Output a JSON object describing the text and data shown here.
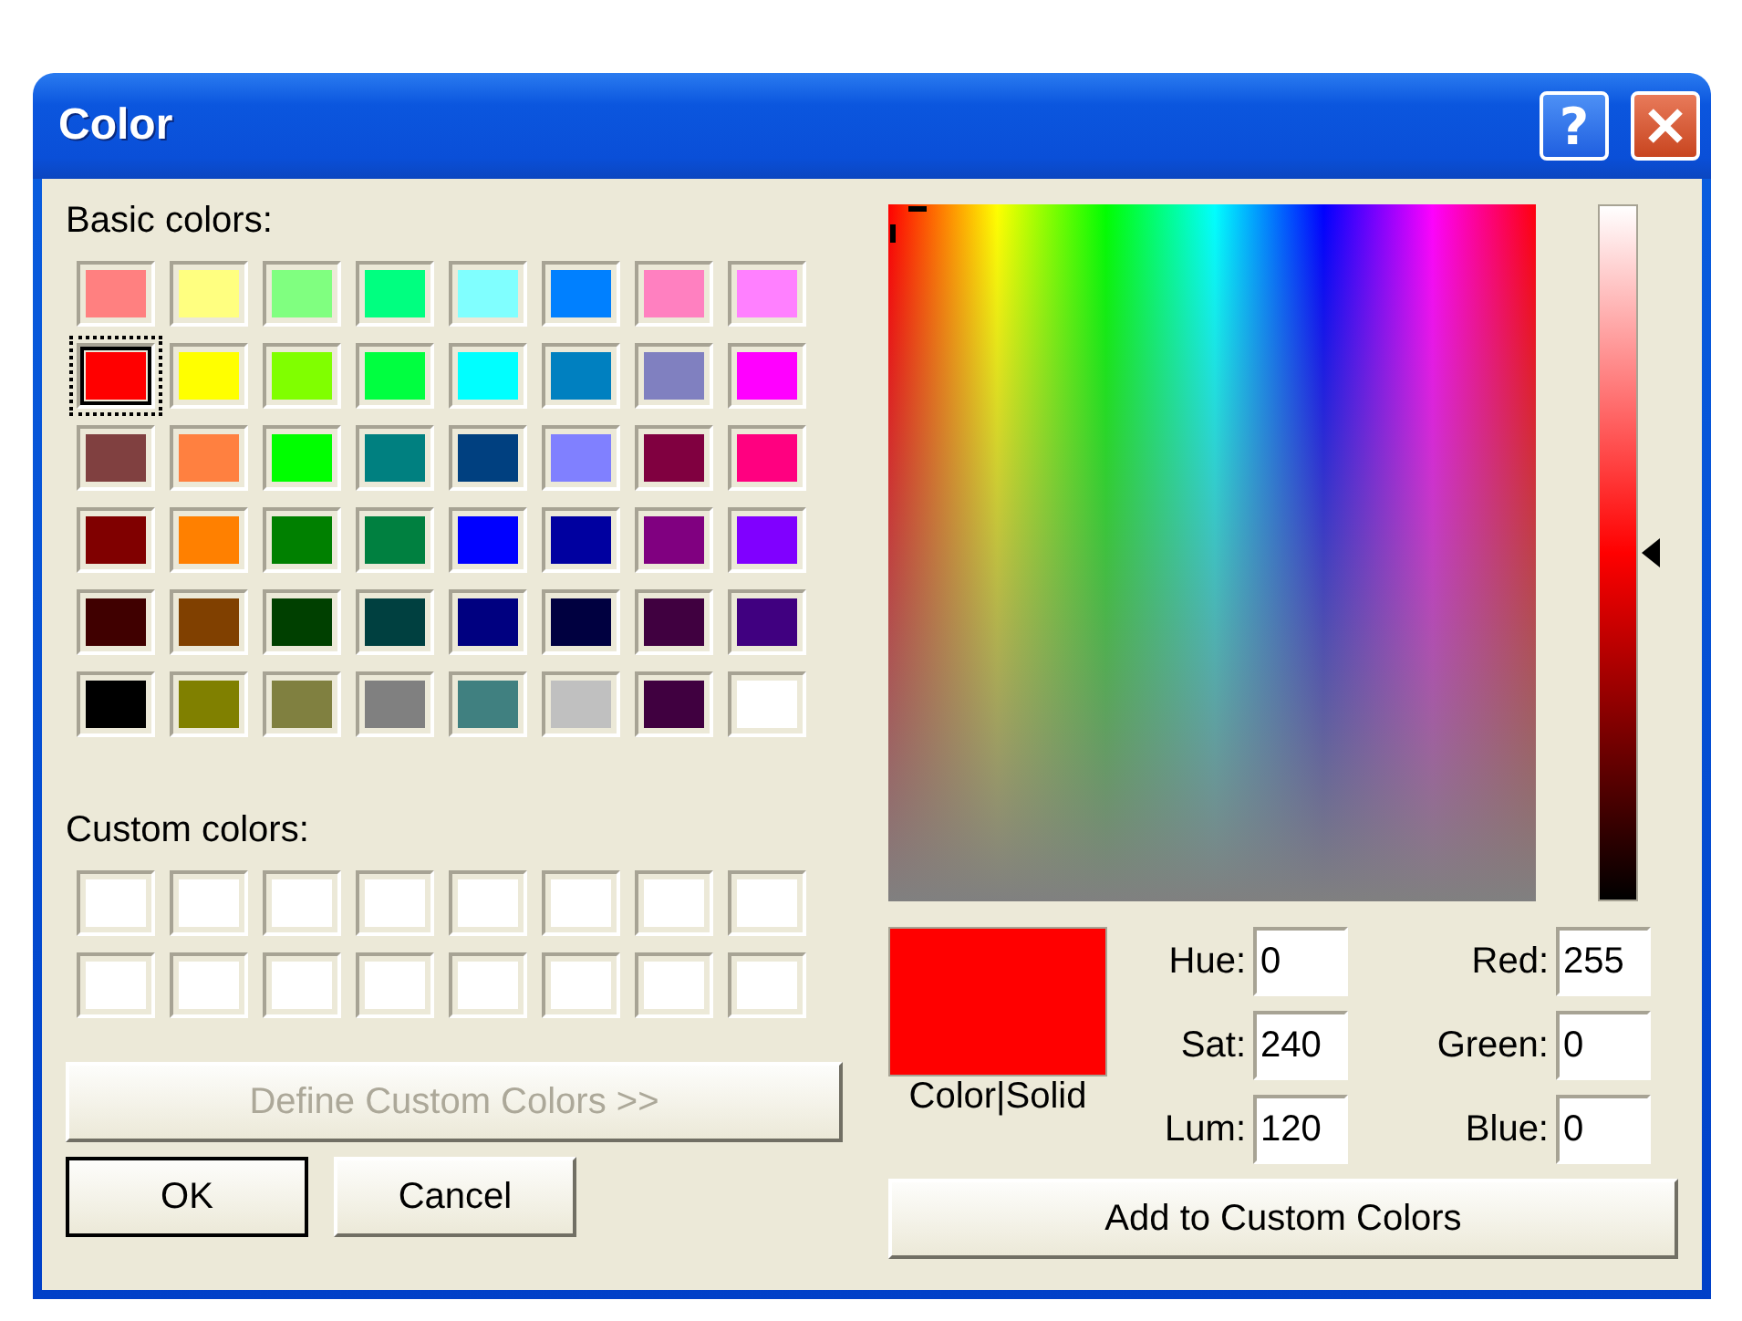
{
  "window": {
    "title": "Color",
    "help_label": "?"
  },
  "basic_colors_label": "Basic colors:",
  "basic_colors": [
    {
      "color": "#ff8080",
      "selected": false
    },
    {
      "color": "#ffff80",
      "selected": false
    },
    {
      "color": "#80ff80",
      "selected": false
    },
    {
      "color": "#00ff80",
      "selected": false
    },
    {
      "color": "#80ffff",
      "selected": false
    },
    {
      "color": "#0080ff",
      "selected": false
    },
    {
      "color": "#ff80c0",
      "selected": false
    },
    {
      "color": "#ff80ff",
      "selected": false
    },
    {
      "color": "#ff0000",
      "selected": true
    },
    {
      "color": "#ffff00",
      "selected": false
    },
    {
      "color": "#80ff00",
      "selected": false
    },
    {
      "color": "#00ff40",
      "selected": false
    },
    {
      "color": "#00ffff",
      "selected": false
    },
    {
      "color": "#0080c0",
      "selected": false
    },
    {
      "color": "#8080c0",
      "selected": false
    },
    {
      "color": "#ff00ff",
      "selected": false
    },
    {
      "color": "#804040",
      "selected": false
    },
    {
      "color": "#ff8040",
      "selected": false
    },
    {
      "color": "#00ff00",
      "selected": false
    },
    {
      "color": "#008080",
      "selected": false
    },
    {
      "color": "#004080",
      "selected": false
    },
    {
      "color": "#8080ff",
      "selected": false
    },
    {
      "color": "#800040",
      "selected": false
    },
    {
      "color": "#ff0080",
      "selected": false
    },
    {
      "color": "#800000",
      "selected": false
    },
    {
      "color": "#ff8000",
      "selected": false
    },
    {
      "color": "#008000",
      "selected": false
    },
    {
      "color": "#008040",
      "selected": false
    },
    {
      "color": "#0000ff",
      "selected": false
    },
    {
      "color": "#0000a0",
      "selected": false
    },
    {
      "color": "#800080",
      "selected": false
    },
    {
      "color": "#8000ff",
      "selected": false
    },
    {
      "color": "#400000",
      "selected": false
    },
    {
      "color": "#804000",
      "selected": false
    },
    {
      "color": "#004000",
      "selected": false
    },
    {
      "color": "#004040",
      "selected": false
    },
    {
      "color": "#000080",
      "selected": false
    },
    {
      "color": "#000040",
      "selected": false
    },
    {
      "color": "#400040",
      "selected": false
    },
    {
      "color": "#400080",
      "selected": false
    },
    {
      "color": "#000000",
      "selected": false
    },
    {
      "color": "#808000",
      "selected": false
    },
    {
      "color": "#808040",
      "selected": false
    },
    {
      "color": "#808080",
      "selected": false
    },
    {
      "color": "#408080",
      "selected": false
    },
    {
      "color": "#c0c0c0",
      "selected": false
    },
    {
      "color": "#400040",
      "selected": false
    },
    {
      "color": "#ffffff",
      "selected": false
    }
  ],
  "custom_colors_label": "Custom colors:",
  "custom_colors": [
    {
      "color": "#ffffff"
    },
    {
      "color": "#ffffff"
    },
    {
      "color": "#ffffff"
    },
    {
      "color": "#ffffff"
    },
    {
      "color": "#ffffff"
    },
    {
      "color": "#ffffff"
    },
    {
      "color": "#ffffff"
    },
    {
      "color": "#ffffff"
    },
    {
      "color": "#ffffff"
    },
    {
      "color": "#ffffff"
    },
    {
      "color": "#ffffff"
    },
    {
      "color": "#ffffff"
    },
    {
      "color": "#ffffff"
    },
    {
      "color": "#ffffff"
    },
    {
      "color": "#ffffff"
    },
    {
      "color": "#ffffff"
    }
  ],
  "define_button": {
    "label": "Define Custom Colors >>",
    "disabled": true
  },
  "dialog_buttons": [
    {
      "label": "OK",
      "default": true
    },
    {
      "label": "Cancel",
      "default": false
    }
  ],
  "luminosity_slider": {
    "level": 0.5
  },
  "preview": {
    "color": "#ff0000",
    "label": "Color|Solid"
  },
  "hsl_fields": [
    {
      "label": "Hue:",
      "value": "0"
    },
    {
      "label": "Sat:",
      "value": "240"
    },
    {
      "label": "Lum:",
      "value": "120"
    }
  ],
  "rgb_fields": [
    {
      "label": "Red:",
      "value": "255"
    },
    {
      "label": "Green:",
      "value": "0"
    },
    {
      "label": "Blue:",
      "value": "0"
    }
  ],
  "add_button": {
    "label": "Add to Custom Colors"
  }
}
